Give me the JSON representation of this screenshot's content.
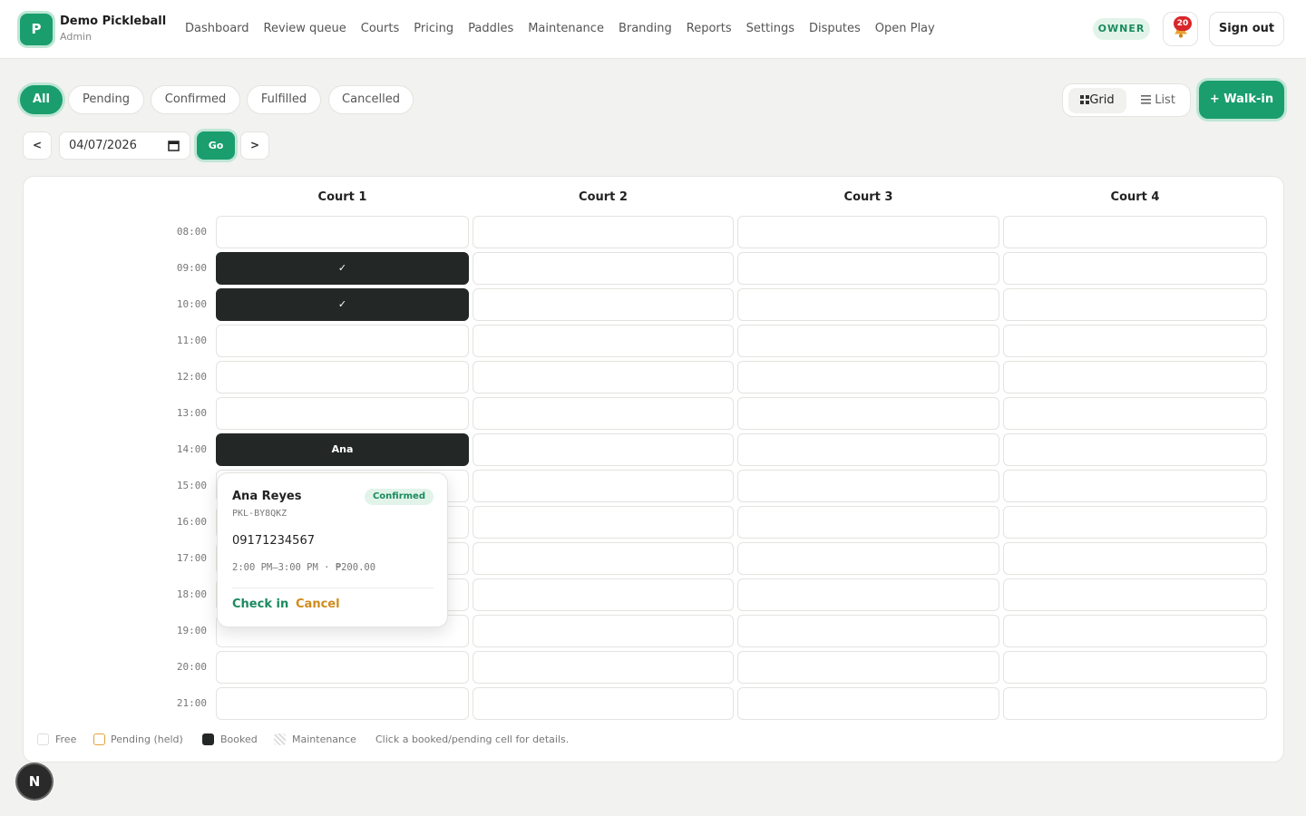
{
  "brand": {
    "logo_letter": "P",
    "name": "Demo Pickleball",
    "role": "Admin",
    "color": "#1a9e6e"
  },
  "nav": [
    "Dashboard",
    "Review queue",
    "Courts",
    "Pricing",
    "Paddles",
    "Maintenance",
    "Branding",
    "Reports",
    "Settings",
    "Disputes",
    "Open Play"
  ],
  "header": {
    "owner_badge": "OWNER",
    "notification_count": "20",
    "sign_out": "Sign out"
  },
  "filters": {
    "items": [
      "All",
      "Pending",
      "Confirmed",
      "Fulfilled",
      "Cancelled"
    ],
    "active": "All"
  },
  "view_toggle": {
    "grid": "Grid",
    "list": "List",
    "active": "Grid"
  },
  "walkin_label": "+ Walk-in",
  "date_nav": {
    "prev": "<",
    "next": ">",
    "date": "04/07/2026",
    "go": "Go"
  },
  "grid": {
    "courts": [
      "Court 1",
      "Court 2",
      "Court 3",
      "Court 4"
    ],
    "times": [
      "08:00",
      "09:00",
      "10:00",
      "11:00",
      "12:00",
      "13:00",
      "14:00",
      "15:00",
      "16:00",
      "17:00",
      "18:00",
      "19:00",
      "20:00",
      "21:00"
    ],
    "booked": [
      {
        "court": 0,
        "time": "09:00",
        "label": "✓"
      },
      {
        "court": 0,
        "time": "10:00",
        "label": "✓"
      },
      {
        "court": 0,
        "time": "14:00",
        "label": "Ana"
      }
    ]
  },
  "popover": {
    "name": "Ana Reyes",
    "status": "Confirmed",
    "code": "PKL-BY8QKZ",
    "phone": "09171234567",
    "meta": "2:00 PM–3:00 PM · ₱200.00",
    "check_in": "Check in",
    "cancel": "Cancel"
  },
  "legend": {
    "free": "Free",
    "pending": "Pending (held)",
    "booked": "Booked",
    "maintenance": "Maintenance",
    "hint": "Click a booked/pending cell for details."
  },
  "corner_badge": "N",
  "colors": {
    "accent": "#1a9e6e",
    "booked": "#232826",
    "pending": "#e2a33b",
    "cancel": "#d08b1a"
  }
}
